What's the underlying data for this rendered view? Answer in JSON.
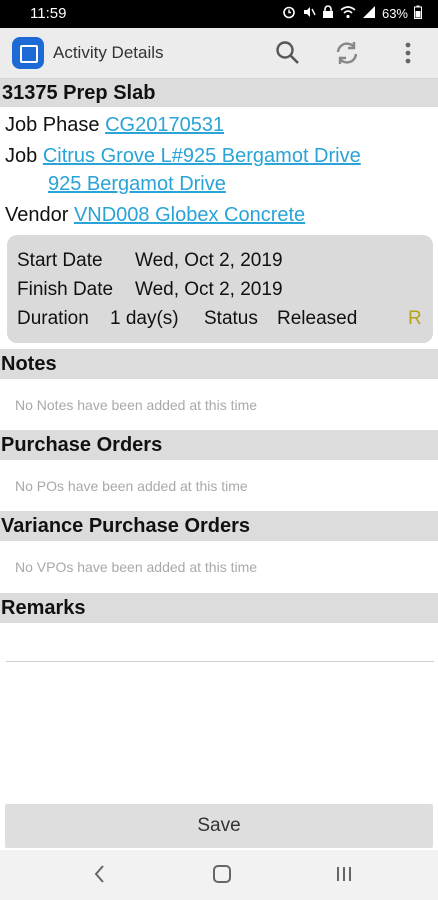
{
  "status_bar": {
    "time": "11:59",
    "battery": "63%",
    "icons": [
      "alarm-icon",
      "mute-icon",
      "lock-icon",
      "wifi-icon",
      "signal-icon",
      "battery-icon"
    ]
  },
  "app_bar": {
    "title": "Activity Details",
    "icons": [
      "search-icon",
      "sync-icon",
      "more-vert-icon"
    ]
  },
  "activity": {
    "title": "31375 Prep Slab",
    "job_phase_label": "Job Phase",
    "job_phase_value": "CG20170531",
    "job_label": "Job",
    "job_value_line1": "Citrus Grove L#925 Bergamot Drive",
    "job_value_line2": "925 Bergamot Drive",
    "vendor_label": "Vendor",
    "vendor_value": "VND008 Globex Concrete"
  },
  "details": {
    "start_label": "Start Date",
    "start_value": "Wed, Oct 2, 2019",
    "finish_label": "Finish Date",
    "finish_value": "Wed, Oct 2, 2019",
    "duration_label": "Duration",
    "duration_value": "1 day(s)",
    "status_label": "Status",
    "status_value": "Released",
    "status_code": "R",
    "status_code_color": "#b5a31a"
  },
  "sections": {
    "notes_title": "Notes",
    "notes_empty": "No Notes have been added at this time",
    "po_title": "Purchase Orders",
    "po_empty": "No POs have been added at this time",
    "vpo_title": "Variance Purchase Orders",
    "vpo_empty": "No VPOs have been added at this time",
    "remarks_title": "Remarks"
  },
  "save_label": "Save",
  "nav_bar": [
    "back-icon",
    "home-icon",
    "recents-icon"
  ]
}
